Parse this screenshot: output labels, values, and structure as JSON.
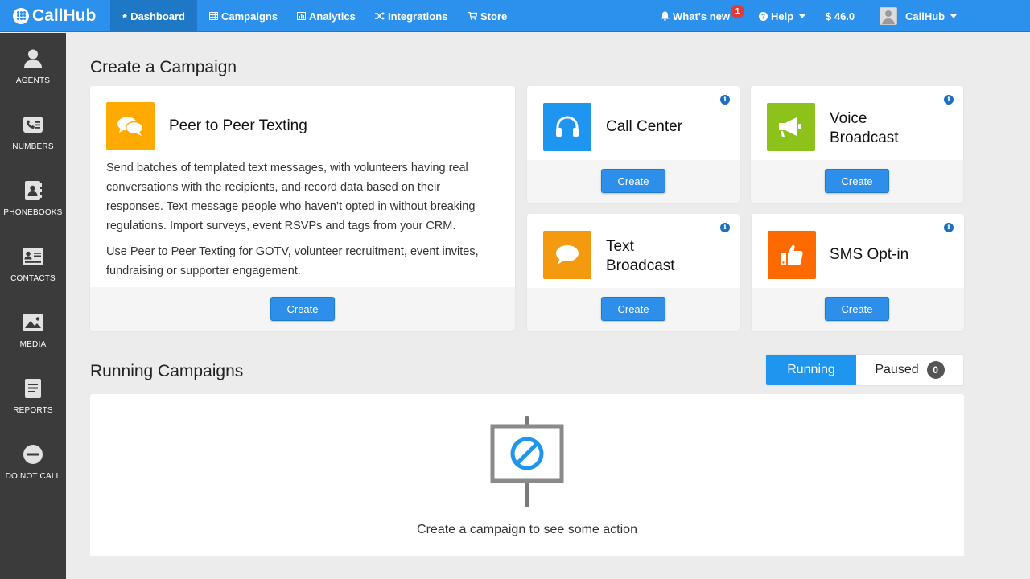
{
  "app": {
    "name": "CallHub"
  },
  "nav": {
    "dashboard": "Dashboard",
    "campaigns": "Campaigns",
    "analytics": "Analytics",
    "integrations": "Integrations",
    "store": "Store",
    "whats_new": "What's new",
    "whats_new_count": "1",
    "help": "Help",
    "balance": "$ 46.0",
    "user": "CallHub"
  },
  "sidebar": {
    "items": [
      {
        "label": "AGENTS",
        "icon": "agent-icon"
      },
      {
        "label": "NUMBERS",
        "icon": "phone-number-icon"
      },
      {
        "label": "PHONEBOOKS",
        "icon": "phonebook-icon"
      },
      {
        "label": "CONTACTS",
        "icon": "contact-card-icon"
      },
      {
        "label": "MEDIA",
        "icon": "image-icon"
      },
      {
        "label": "REPORTS",
        "icon": "report-icon"
      },
      {
        "label": "DO NOT CALL",
        "icon": "do-not-call-icon"
      }
    ]
  },
  "create": {
    "title": "Create a Campaign",
    "button_label": "Create",
    "p2p": {
      "title": "Peer to Peer Texting",
      "desc1": "Send batches of templated text messages, with volunteers having real conversations with the recipients, and record data based on their responses. Text message people who haven’t opted in without breaking regulations. Import surveys, event RSVPs and tags from your CRM.",
      "desc2": "Use Peer to Peer Texting for GOTV, volunteer recruitment, event invites, fundraising or supporter engagement.",
      "color": "#ffaa00"
    },
    "call_center": {
      "title": "Call Center",
      "color": "#1e96ef"
    },
    "voice_broadcast": {
      "title_line1": "Voice",
      "title_line2": "Broadcast",
      "color": "#8cc21a"
    },
    "text_broadcast": {
      "title_line1": "Text",
      "title_line2": "Broadcast",
      "color": "#f39a0e"
    },
    "sms_optin": {
      "title": "SMS Opt-in",
      "color": "#ff6a00"
    }
  },
  "running": {
    "title": "Running Campaigns",
    "tab_running": "Running",
    "tab_paused": "Paused",
    "paused_count": "0",
    "empty_text": "Create a campaign to see some action"
  },
  "colors": {
    "accent": "#2b91ec",
    "sidebar": "#3b3b3b",
    "button": "#2d8fea"
  }
}
